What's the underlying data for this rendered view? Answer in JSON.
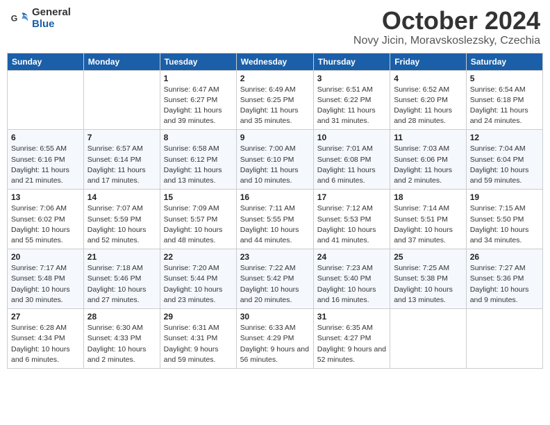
{
  "header": {
    "logo_general": "General",
    "logo_blue": "Blue",
    "month": "October 2024",
    "location": "Novy Jicin, Moravskoslezsky, Czechia"
  },
  "columns": [
    "Sunday",
    "Monday",
    "Tuesday",
    "Wednesday",
    "Thursday",
    "Friday",
    "Saturday"
  ],
  "weeks": [
    [
      {
        "day": "",
        "info": ""
      },
      {
        "day": "",
        "info": ""
      },
      {
        "day": "1",
        "info": "Sunrise: 6:47 AM\nSunset: 6:27 PM\nDaylight: 11 hours and 39 minutes."
      },
      {
        "day": "2",
        "info": "Sunrise: 6:49 AM\nSunset: 6:25 PM\nDaylight: 11 hours and 35 minutes."
      },
      {
        "day": "3",
        "info": "Sunrise: 6:51 AM\nSunset: 6:22 PM\nDaylight: 11 hours and 31 minutes."
      },
      {
        "day": "4",
        "info": "Sunrise: 6:52 AM\nSunset: 6:20 PM\nDaylight: 11 hours and 28 minutes."
      },
      {
        "day": "5",
        "info": "Sunrise: 6:54 AM\nSunset: 6:18 PM\nDaylight: 11 hours and 24 minutes."
      }
    ],
    [
      {
        "day": "6",
        "info": "Sunrise: 6:55 AM\nSunset: 6:16 PM\nDaylight: 11 hours and 21 minutes."
      },
      {
        "day": "7",
        "info": "Sunrise: 6:57 AM\nSunset: 6:14 PM\nDaylight: 11 hours and 17 minutes."
      },
      {
        "day": "8",
        "info": "Sunrise: 6:58 AM\nSunset: 6:12 PM\nDaylight: 11 hours and 13 minutes."
      },
      {
        "day": "9",
        "info": "Sunrise: 7:00 AM\nSunset: 6:10 PM\nDaylight: 11 hours and 10 minutes."
      },
      {
        "day": "10",
        "info": "Sunrise: 7:01 AM\nSunset: 6:08 PM\nDaylight: 11 hours and 6 minutes."
      },
      {
        "day": "11",
        "info": "Sunrise: 7:03 AM\nSunset: 6:06 PM\nDaylight: 11 hours and 2 minutes."
      },
      {
        "day": "12",
        "info": "Sunrise: 7:04 AM\nSunset: 6:04 PM\nDaylight: 10 hours and 59 minutes."
      }
    ],
    [
      {
        "day": "13",
        "info": "Sunrise: 7:06 AM\nSunset: 6:02 PM\nDaylight: 10 hours and 55 minutes."
      },
      {
        "day": "14",
        "info": "Sunrise: 7:07 AM\nSunset: 5:59 PM\nDaylight: 10 hours and 52 minutes."
      },
      {
        "day": "15",
        "info": "Sunrise: 7:09 AM\nSunset: 5:57 PM\nDaylight: 10 hours and 48 minutes."
      },
      {
        "day": "16",
        "info": "Sunrise: 7:11 AM\nSunset: 5:55 PM\nDaylight: 10 hours and 44 minutes."
      },
      {
        "day": "17",
        "info": "Sunrise: 7:12 AM\nSunset: 5:53 PM\nDaylight: 10 hours and 41 minutes."
      },
      {
        "day": "18",
        "info": "Sunrise: 7:14 AM\nSunset: 5:51 PM\nDaylight: 10 hours and 37 minutes."
      },
      {
        "day": "19",
        "info": "Sunrise: 7:15 AM\nSunset: 5:50 PM\nDaylight: 10 hours and 34 minutes."
      }
    ],
    [
      {
        "day": "20",
        "info": "Sunrise: 7:17 AM\nSunset: 5:48 PM\nDaylight: 10 hours and 30 minutes."
      },
      {
        "day": "21",
        "info": "Sunrise: 7:18 AM\nSunset: 5:46 PM\nDaylight: 10 hours and 27 minutes."
      },
      {
        "day": "22",
        "info": "Sunrise: 7:20 AM\nSunset: 5:44 PM\nDaylight: 10 hours and 23 minutes."
      },
      {
        "day": "23",
        "info": "Sunrise: 7:22 AM\nSunset: 5:42 PM\nDaylight: 10 hours and 20 minutes."
      },
      {
        "day": "24",
        "info": "Sunrise: 7:23 AM\nSunset: 5:40 PM\nDaylight: 10 hours and 16 minutes."
      },
      {
        "day": "25",
        "info": "Sunrise: 7:25 AM\nSunset: 5:38 PM\nDaylight: 10 hours and 13 minutes."
      },
      {
        "day": "26",
        "info": "Sunrise: 7:27 AM\nSunset: 5:36 PM\nDaylight: 10 hours and 9 minutes."
      }
    ],
    [
      {
        "day": "27",
        "info": "Sunrise: 6:28 AM\nSunset: 4:34 PM\nDaylight: 10 hours and 6 minutes."
      },
      {
        "day": "28",
        "info": "Sunrise: 6:30 AM\nSunset: 4:33 PM\nDaylight: 10 hours and 2 minutes."
      },
      {
        "day": "29",
        "info": "Sunrise: 6:31 AM\nSunset: 4:31 PM\nDaylight: 9 hours and 59 minutes."
      },
      {
        "day": "30",
        "info": "Sunrise: 6:33 AM\nSunset: 4:29 PM\nDaylight: 9 hours and 56 minutes."
      },
      {
        "day": "31",
        "info": "Sunrise: 6:35 AM\nSunset: 4:27 PM\nDaylight: 9 hours and 52 minutes."
      },
      {
        "day": "",
        "info": ""
      },
      {
        "day": "",
        "info": ""
      }
    ]
  ]
}
